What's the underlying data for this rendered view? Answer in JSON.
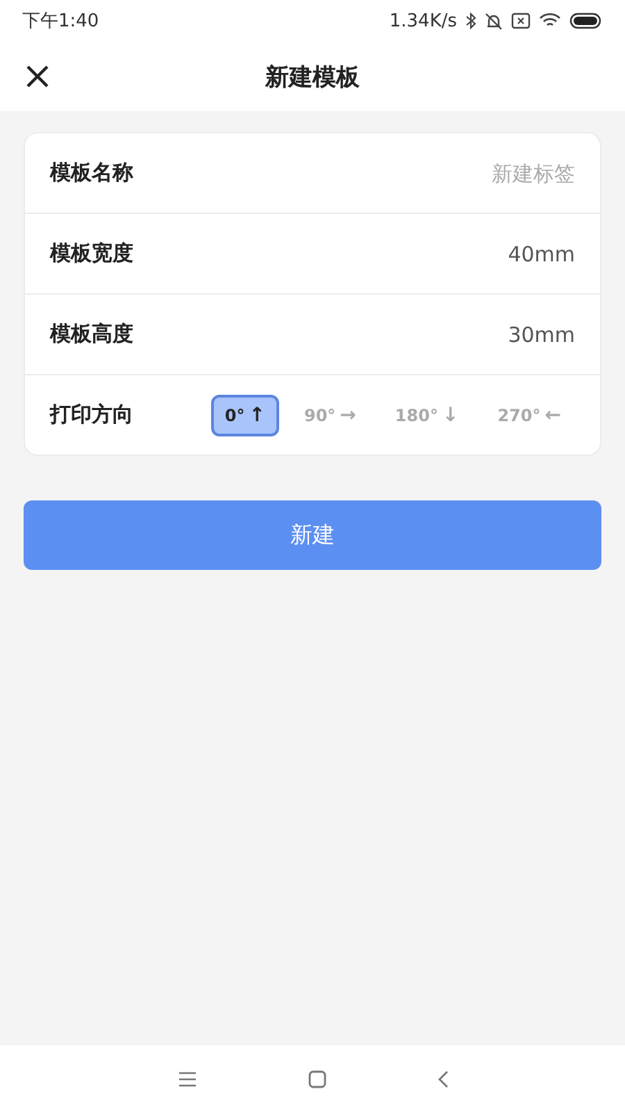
{
  "status_bar": {
    "time": "下午1:40",
    "speed": "1.34K/s"
  },
  "header": {
    "title": "新建模板"
  },
  "form": {
    "name": {
      "label": "模板名称",
      "placeholder": "新建标签"
    },
    "width": {
      "label": "模板宽度",
      "value": "40mm"
    },
    "height": {
      "label": "模板高度",
      "value": "30mm"
    },
    "direction": {
      "label": "打印方向",
      "options": [
        {
          "label": "0°",
          "arrow": "↑",
          "selected": true
        },
        {
          "label": "90°",
          "arrow": "→",
          "selected": false
        },
        {
          "label": "180°",
          "arrow": "↓",
          "selected": false
        },
        {
          "label": "270°",
          "arrow": "←",
          "selected": false
        }
      ]
    }
  },
  "submit": "新建"
}
